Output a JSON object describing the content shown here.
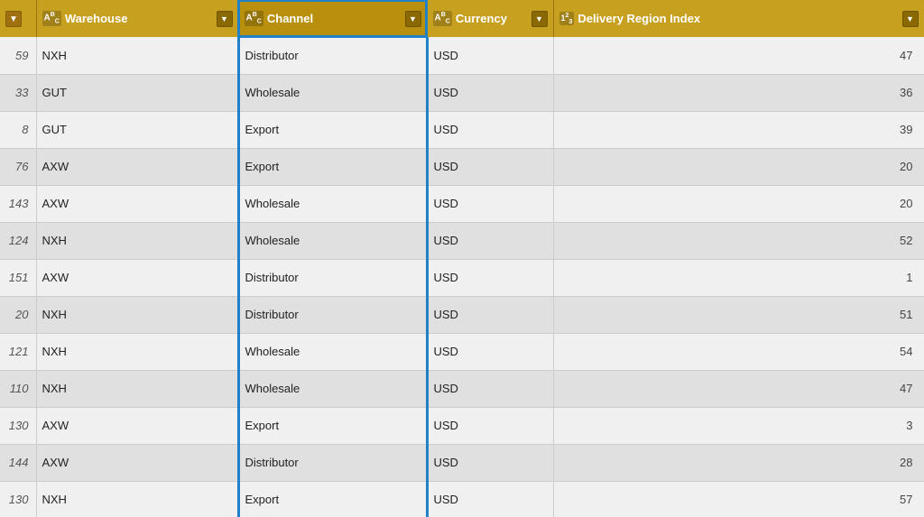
{
  "columns": {
    "index": {
      "label": ""
    },
    "warehouse": {
      "label": "Warehouse",
      "type": "abc"
    },
    "channel": {
      "label": "Channel",
      "type": "abc"
    },
    "currency": {
      "label": "Currency",
      "type": "abc"
    },
    "delivery": {
      "label": "Delivery Region Index",
      "type": "num"
    }
  },
  "rows": [
    {
      "index": 59,
      "warehouse": "NXH",
      "channel": "Distributor",
      "currency": "USD",
      "delivery": 47
    },
    {
      "index": 33,
      "warehouse": "GUT",
      "channel": "Wholesale",
      "currency": "USD",
      "delivery": 36
    },
    {
      "index": 8,
      "warehouse": "GUT",
      "channel": "Export",
      "currency": "USD",
      "delivery": 39
    },
    {
      "index": 76,
      "warehouse": "AXW",
      "channel": "Export",
      "currency": "USD",
      "delivery": 20
    },
    {
      "index": 143,
      "warehouse": "AXW",
      "channel": "Wholesale",
      "currency": "USD",
      "delivery": 20
    },
    {
      "index": 124,
      "warehouse": "NXH",
      "channel": "Wholesale",
      "currency": "USD",
      "delivery": 52
    },
    {
      "index": 151,
      "warehouse": "AXW",
      "channel": "Distributor",
      "currency": "USD",
      "delivery": 1
    },
    {
      "index": 20,
      "warehouse": "NXH",
      "channel": "Distributor",
      "currency": "USD",
      "delivery": 51
    },
    {
      "index": 121,
      "warehouse": "NXH",
      "channel": "Wholesale",
      "currency": "USD",
      "delivery": 54
    },
    {
      "index": 110,
      "warehouse": "NXH",
      "channel": "Wholesale",
      "currency": "USD",
      "delivery": 47
    },
    {
      "index": 130,
      "warehouse": "AXW",
      "channel": "Export",
      "currency": "USD",
      "delivery": 3
    },
    {
      "index": 144,
      "warehouse": "AXW",
      "channel": "Distributor",
      "currency": "USD",
      "delivery": 28
    },
    {
      "index": 130,
      "warehouse": "NXH",
      "channel": "Export",
      "currency": "USD",
      "delivery": 57
    }
  ],
  "ui": {
    "sort_asc_label": "▲",
    "sort_desc_label": "▼",
    "dropdown_arrow": "▼",
    "abc_label": "ABC",
    "num_label": "123"
  }
}
